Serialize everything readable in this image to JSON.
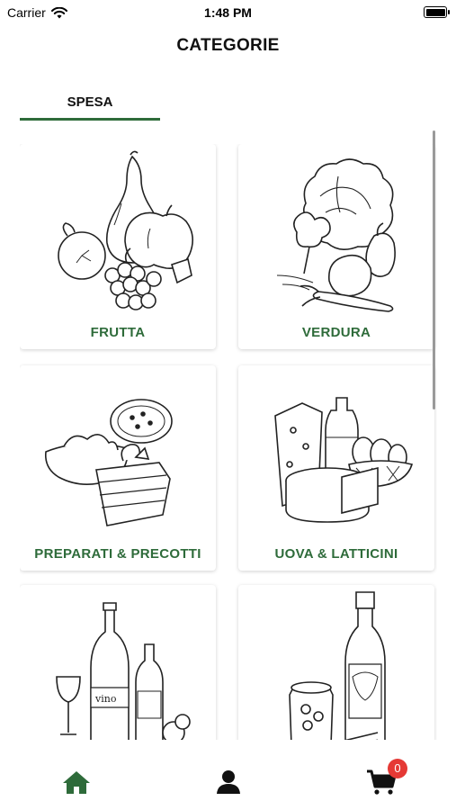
{
  "status_bar": {
    "carrier": "Carrier",
    "time": "1:48 PM"
  },
  "header": {
    "title": "CATEGORIE"
  },
  "tabs": [
    {
      "label": "SPESA",
      "active": true
    }
  ],
  "categories": [
    {
      "label": "FRUTTA",
      "icon": "fruit-illustration"
    },
    {
      "label": "VERDURA",
      "icon": "vegetables-illustration"
    },
    {
      "label": "PREPARATI & PRECOTTI",
      "icon": "prepared-food-illustration"
    },
    {
      "label": "UOVA & LATTICINI",
      "icon": "dairy-illustration"
    },
    {
      "label": "",
      "icon": "wine-illustration"
    },
    {
      "label": "",
      "icon": "oil-preserves-illustration"
    }
  ],
  "tab_bar": {
    "items": [
      "home-icon",
      "profile-icon",
      "cart-icon"
    ],
    "cart_count": "0"
  },
  "colors": {
    "accent": "#2e6b3a",
    "badge": "#e53935"
  }
}
